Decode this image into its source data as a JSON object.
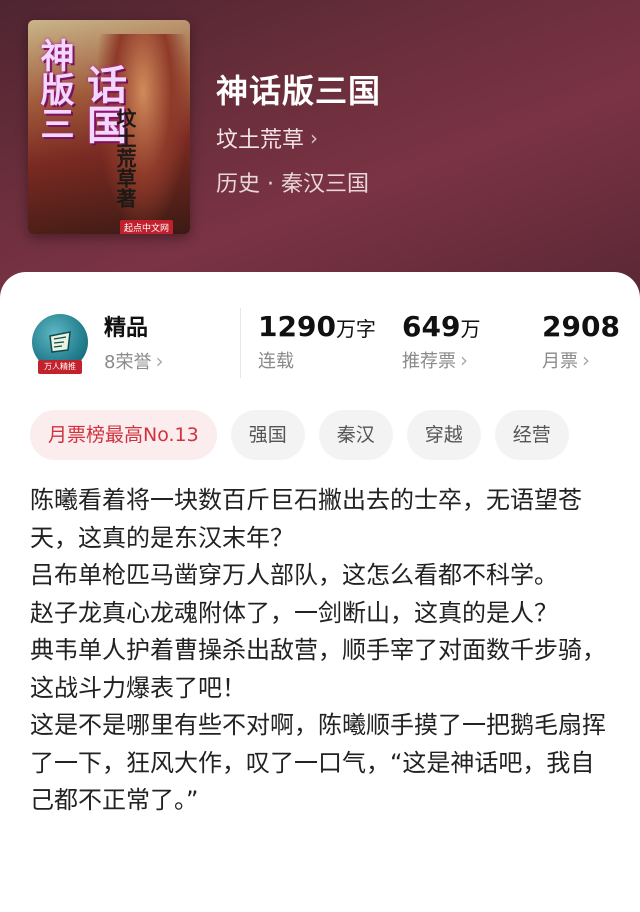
{
  "book": {
    "title": "神话版三国",
    "author": "坟土荒草",
    "genre": "历史 · 秦汉三国",
    "cover": {
      "title_art_1": "神版三",
      "title_art_2": "话国",
      "author_art": "坟土荒草著",
      "publisher_logo": "起点中文网"
    }
  },
  "honor": {
    "label": "精品",
    "count_label": "8荣誉",
    "badge_text": "万人精推"
  },
  "stats": [
    {
      "number": "1290",
      "unit": "万字",
      "label": "连载",
      "has_chevron": false
    },
    {
      "number": "649",
      "unit": "万",
      "label": "推荐票",
      "has_chevron": true
    },
    {
      "number": "2908",
      "unit": "",
      "label": "月票",
      "has_chevron": true
    }
  ],
  "tags": [
    "月票榜最高No.13",
    "强国",
    "秦汉",
    "穿越",
    "经营"
  ],
  "description": "陈曦看着将一块数百斤巨石撇出去的士卒，无语望苍天，这真的是东汉末年？\n吕布单枪匹马凿穿万人部队，这怎么看都不科学。\n赵子龙真心龙魂附体了，一剑断山，这真的是人？\n典韦单人护着曹操杀出敌营，顺手宰了对面数千步骑，这战斗力爆表了吧！\n这是不是哪里有些不对啊，陈曦顺手摸了一把鹅毛扇挥了一下，狂风大作，叹了一口气，“这是神话吧，我自己都不正常了。”",
  "colors": {
    "hero_bg": "#6a2e3b",
    "accent_red": "#d0333f",
    "tag_bg": "#f3f3f3"
  },
  "icons": {
    "chevron": "chevron-right-icon"
  }
}
